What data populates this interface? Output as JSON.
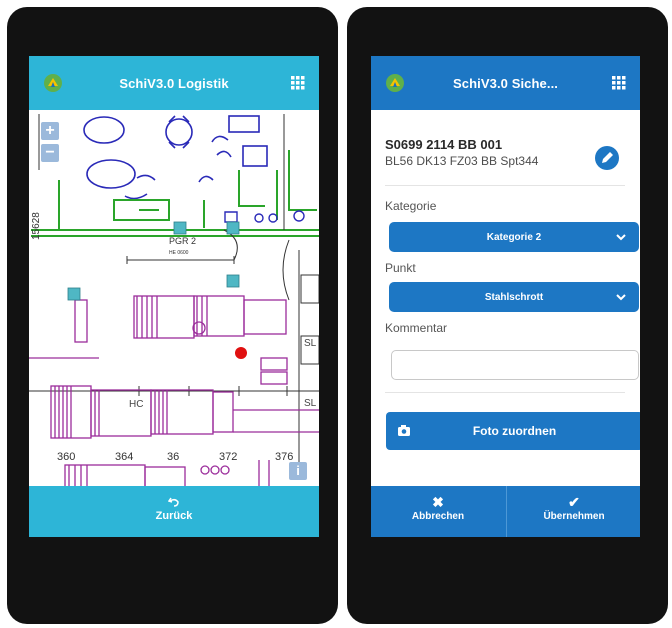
{
  "left": {
    "title": "SchiV3.0 Logistik",
    "map": {
      "zoom_in": "+",
      "zoom_out": "−",
      "info": "i",
      "labels": {
        "vertical_15628": "15628",
        "pgr2": "PGR 2",
        "hc": "HC",
        "sl1": "SL",
        "sl2": "SL",
        "dim": "HE 0600",
        "x360": "360",
        "x364": "364",
        "x368": "36",
        "x372": "372",
        "x376": "376"
      }
    },
    "bottom": {
      "back_label": "Zurück",
      "back_icon": "undo-icon"
    }
  },
  "right": {
    "title": "SchiV3.0 Siche...",
    "record": {
      "id": "S0699 2114 BB 001",
      "sub": "BL56 DK13 FZ03 BB Spt344"
    },
    "form": {
      "kategorie_label": "Kategorie",
      "kategorie_value": "Kategorie 2",
      "punkt_label": "Punkt",
      "punkt_value": "Stahlschrott",
      "kommentar_label": "Kommentar",
      "kommentar_value": "",
      "foto_button": "Foto zuordnen"
    },
    "bottom": {
      "cancel_label": "Abbrechen",
      "cancel_symbol": "✖",
      "apply_label": "Übernehmen",
      "apply_symbol": "✔"
    }
  },
  "colors": {
    "cyan_bar": "#2db5d7",
    "blue_bar": "#1d77c4",
    "map_green": "#2aa52a",
    "map_purple": "#9b2d9b",
    "map_blue": "#2a2ab8",
    "marker_red": "#e01010",
    "marker_teal": "#4fb7c4"
  }
}
